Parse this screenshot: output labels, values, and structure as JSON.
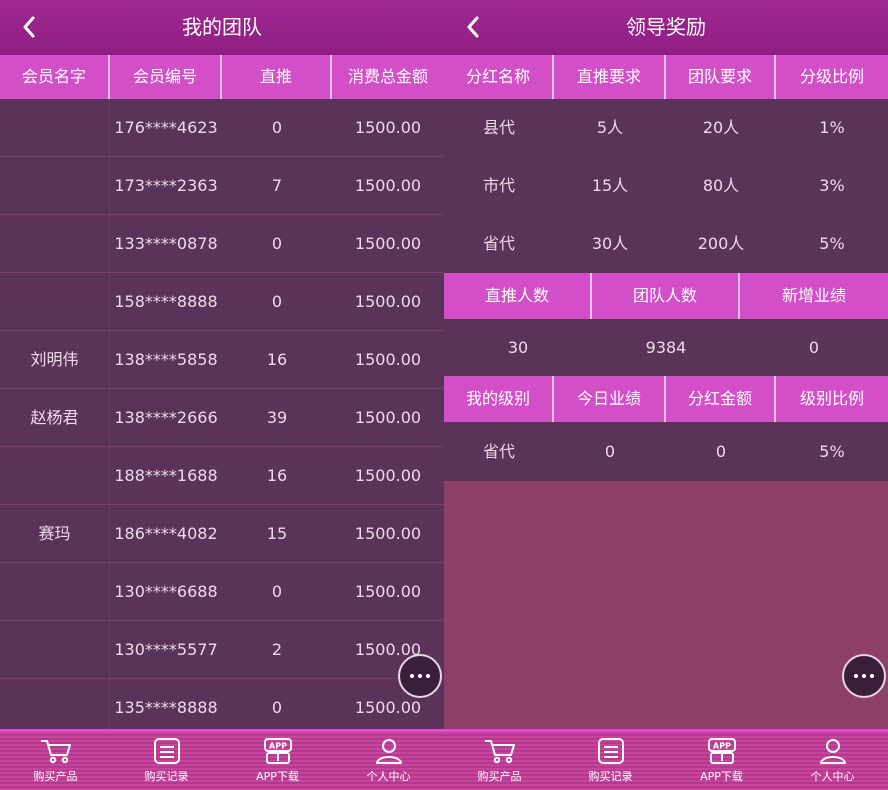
{
  "left": {
    "title": "我的团队",
    "columns": [
      "会员名字",
      "会员编号",
      "直推",
      "消费总金额"
    ],
    "rows": [
      {
        "name": "",
        "id": "176****4623",
        "direct": "0",
        "total": "1500.00"
      },
      {
        "name": "",
        "id": "173****2363",
        "direct": "7",
        "total": "1500.00"
      },
      {
        "name": "",
        "id": "133****0878",
        "direct": "0",
        "total": "1500.00"
      },
      {
        "name": "",
        "id": "158****8888",
        "direct": "0",
        "total": "1500.00"
      },
      {
        "name": "刘明伟",
        "id": "138****5858",
        "direct": "16",
        "total": "1500.00"
      },
      {
        "name": "赵杨君",
        "id": "138****2666",
        "direct": "39",
        "total": "1500.00"
      },
      {
        "name": "",
        "id": "188****1688",
        "direct": "16",
        "total": "1500.00"
      },
      {
        "name": "赛玛",
        "id": "186****4082",
        "direct": "15",
        "total": "1500.00"
      },
      {
        "name": "",
        "id": "130****6688",
        "direct": "0",
        "total": "1500.00"
      },
      {
        "name": "",
        "id": "130****5577",
        "direct": "2",
        "total": "1500.00"
      },
      {
        "name": "",
        "id": "135****8888",
        "direct": "0",
        "total": "1500.00"
      }
    ]
  },
  "right": {
    "title": "领导奖励",
    "dividend_columns": [
      "分红名称",
      "直推要求",
      "团队要求",
      "分级比例"
    ],
    "dividend_rows": [
      {
        "name": "县代",
        "direct_req": "5人",
        "team_req": "20人",
        "ratio": "1%"
      },
      {
        "name": "市代",
        "direct_req": "15人",
        "team_req": "80人",
        "ratio": "3%"
      },
      {
        "name": "省代",
        "direct_req": "30人",
        "team_req": "200人",
        "ratio": "5%"
      }
    ],
    "stats_columns": [
      "直推人数",
      "团队人数",
      "新增业绩"
    ],
    "stats_values": [
      "30",
      "9384",
      "0"
    ],
    "level_columns": [
      "我的级别",
      "今日业绩",
      "分红金额",
      "级别比例"
    ],
    "level_values": [
      "省代",
      "0",
      "0",
      "5%"
    ]
  },
  "tabbar": [
    {
      "label": "购买产品",
      "icon": "cart-icon"
    },
    {
      "label": "购买记录",
      "icon": "list-icon"
    },
    {
      "label": "APP下载",
      "icon": "app-download-icon"
    },
    {
      "label": "个人中心",
      "icon": "user-icon"
    }
  ],
  "colors": {
    "header_bar": "#9a2590",
    "table_header": "#d24fc8",
    "body_bg": "#5a3358",
    "empty_area": "#8c4068"
  }
}
